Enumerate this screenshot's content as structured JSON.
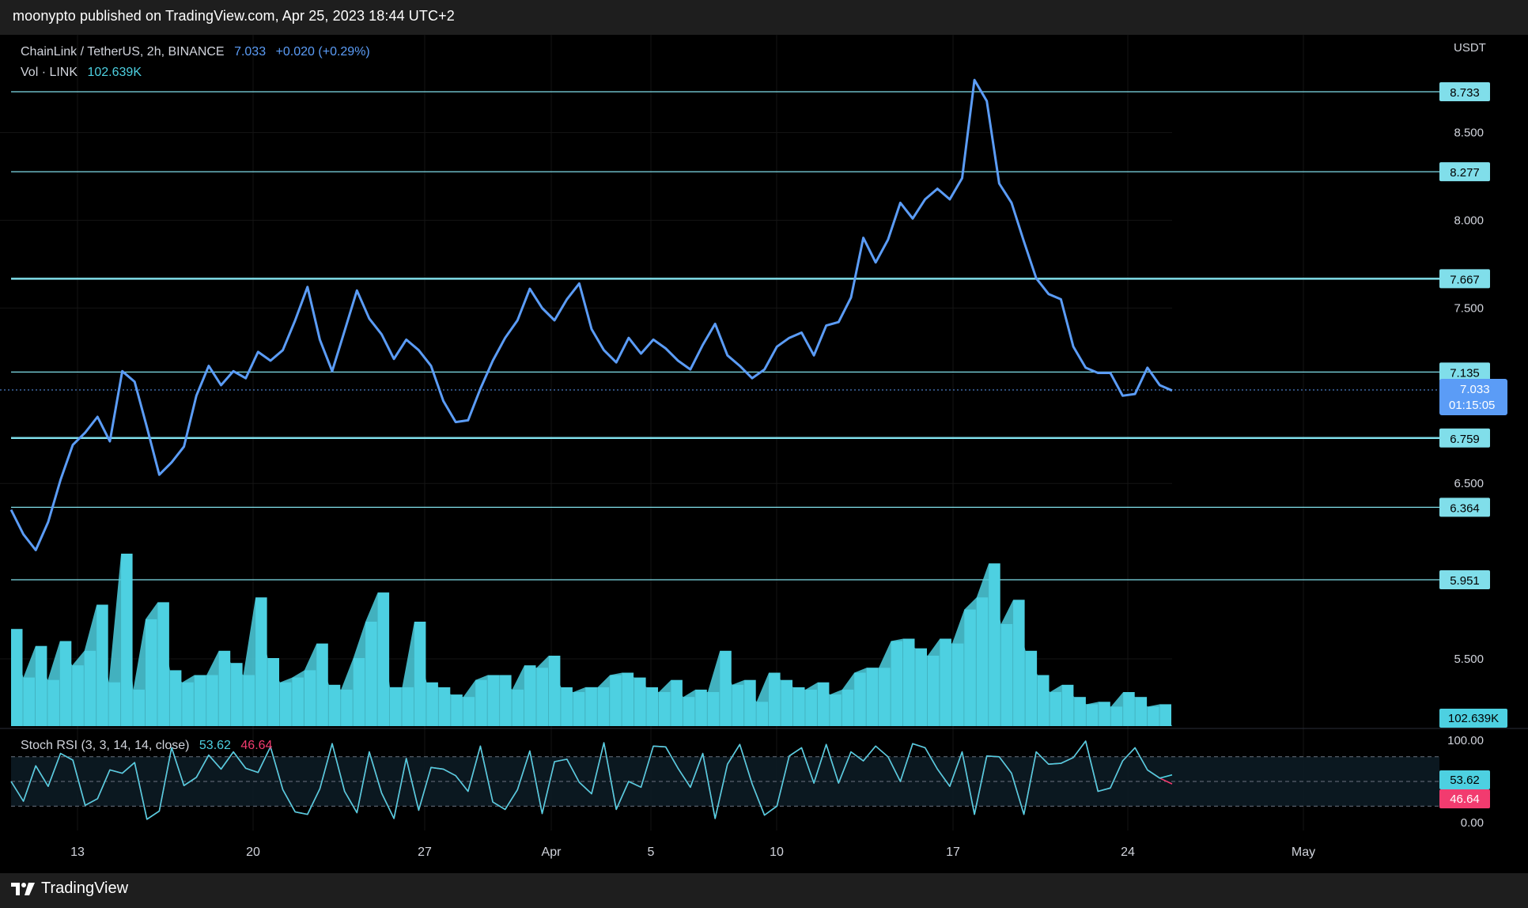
{
  "header": {
    "text": "moonypto published on TradingView.com, Apr 25, 2023 18:44 UTC+2"
  },
  "footer": {
    "brand": "TradingView"
  },
  "legend": {
    "symbol": "ChainLink / TetherUS, 2h, BINANCE",
    "price": "7.033",
    "change": "+0.020 (+0.29%)",
    "vol_label": "Vol · LINK",
    "vol_value": "102.639K"
  },
  "rsi_legend": {
    "label": "Stoch RSI (3, 3, 14, 14, close)",
    "k": "53.62",
    "d": "46.64"
  },
  "price_axis": {
    "unit": "USDT",
    "ticks": [
      "8.500",
      "8.000",
      "7.500",
      "6.500",
      "5.500"
    ]
  },
  "rsi_axis": {
    "ticks": [
      "100.00",
      "0.00"
    ]
  },
  "time_axis": {
    "labels": [
      "13",
      "20",
      "27",
      "Apr",
      "5",
      "10",
      "17",
      "24",
      "May"
    ]
  },
  "price_tags": {
    "current_price": "7.033",
    "countdown": "01:15:05",
    "volume": "102.639K",
    "stoch_k": "53.62",
    "stoch_d": "46.64"
  },
  "colors": {
    "price_line": "#5b9cf6",
    "level_lines": "#80deea",
    "volume": "#4dd0e1",
    "stoch_k": "#4dd0e1",
    "stoch_d": "#f23b6f",
    "background": "#000000"
  },
  "chart_data": [
    {
      "type": "line",
      "series": [
        {
          "name": "ChainLink / TetherUS",
          "values": [
            6.35,
            6.21,
            6.12,
            6.28,
            6.52,
            6.72,
            6.79,
            6.88,
            6.74,
            7.14,
            7.08,
            6.82,
            6.55,
            6.62,
            6.71,
            7.0,
            7.17,
            7.06,
            7.14,
            7.1,
            7.25,
            7.2,
            7.26,
            7.43,
            7.62,
            7.32,
            7.14,
            7.37,
            7.6,
            7.44,
            7.35,
            7.21,
            7.32,
            7.26,
            7.17,
            6.97,
            6.85,
            6.86,
            7.04,
            7.2,
            7.33,
            7.43,
            7.61,
            7.5,
            7.43,
            7.55,
            7.64,
            7.38,
            7.26,
            7.19,
            7.33,
            7.24,
            7.32,
            7.27,
            7.2,
            7.15,
            7.29,
            7.41,
            7.23,
            7.17,
            7.1,
            7.15,
            7.28,
            7.33,
            7.36,
            7.23,
            7.4,
            7.42,
            7.56,
            7.9,
            7.76,
            7.89,
            8.1,
            8.01,
            8.12,
            8.18,
            8.12,
            8.24,
            8.8,
            8.68,
            8.21,
            8.1,
            7.88,
            7.67,
            7.58,
            7.55,
            7.28,
            7.16,
            7.13,
            7.13,
            7.0,
            7.01,
            7.16,
            7.06,
            7.03
          ]
        }
      ],
      "x_labels": [
        "13",
        "20",
        "27",
        "Apr",
        "5",
        "10",
        "17",
        "24",
        "May"
      ],
      "horizontal_levels": [
        8.733,
        8.277,
        7.667,
        7.135,
        6.759,
        6.364,
        5.951
      ],
      "last_value": 7.033,
      "yticks": [
        8.5,
        8.0,
        7.5,
        6.5,
        5.5
      ],
      "ylim": [
        5.3,
        8.95
      ]
    },
    {
      "type": "bar",
      "series": [
        {
          "name": "Vol · LINK",
          "values": [
            40,
            20,
            33,
            19,
            35,
            25,
            31,
            50,
            18,
            71,
            15,
            44,
            51,
            23,
            18,
            21,
            21,
            31,
            26,
            21,
            53,
            28,
            18,
            20,
            23,
            34,
            17,
            15,
            28,
            43,
            55,
            16,
            16,
            43,
            18,
            16,
            13,
            12,
            19,
            21,
            21,
            15,
            25,
            24,
            29,
            16,
            14,
            16,
            16,
            21,
            22,
            20,
            16,
            14,
            19,
            12,
            15,
            14,
            31,
            17,
            19,
            10,
            22,
            19,
            16,
            15,
            18,
            13,
            15,
            22,
            24,
            24,
            35,
            36,
            32,
            29,
            36,
            34,
            48,
            53,
            67,
            42,
            52,
            31,
            21,
            14,
            17,
            12,
            9,
            10,
            8,
            14,
            12,
            8,
            9
          ]
        }
      ],
      "last_value": "102.639K"
    },
    {
      "type": "line",
      "series": [
        {
          "name": "%K",
          "values": [
            50,
            26,
            69,
            44,
            84,
            76,
            21,
            29,
            64,
            60,
            73,
            4,
            14,
            91,
            45,
            55,
            82,
            65,
            86,
            66,
            61,
            92,
            40,
            13,
            10,
            41,
            96,
            38,
            12,
            86,
            36,
            5,
            78,
            15,
            67,
            65,
            57,
            38,
            93,
            25,
            16,
            40,
            87,
            11,
            74,
            77,
            49,
            35,
            97,
            16,
            50,
            43,
            93,
            92,
            66,
            43,
            84,
            5,
            71,
            95,
            47,
            9,
            20,
            81,
            91,
            48,
            95,
            48,
            86,
            75,
            93,
            80,
            50,
            96,
            91,
            65,
            44,
            86,
            10,
            81,
            80,
            60,
            10,
            86,
            71,
            72,
            79,
            99,
            38,
            42,
            75,
            91,
            64,
            54,
            58
          ]
        },
        {
          "name": "%D",
          "values": [
            50,
            26,
            69,
            44,
            84,
            76,
            21,
            29,
            64,
            60,
            73,
            4,
            14,
            91,
            45,
            55,
            82,
            65,
            86,
            66,
            61,
            92,
            40,
            13,
            10,
            41,
            96,
            38,
            12,
            86,
            36,
            5,
            78,
            15,
            67,
            65,
            57,
            38,
            93,
            25,
            16,
            40,
            87,
            11,
            74,
            77,
            49,
            35,
            97,
            16,
            50,
            43,
            93,
            92,
            66,
            43,
            84,
            5,
            71,
            95,
            47,
            9,
            20,
            81,
            91,
            48,
            95,
            48,
            86,
            75,
            93,
            80,
            50,
            96,
            91,
            65,
            44,
            86,
            10,
            81,
            80,
            60,
            10,
            86,
            71,
            72,
            79,
            99,
            38,
            42,
            75,
            91,
            64,
            54,
            47
          ]
        }
      ],
      "yticks": [
        100,
        0
      ],
      "ylim": [
        0,
        100
      ]
    }
  ]
}
